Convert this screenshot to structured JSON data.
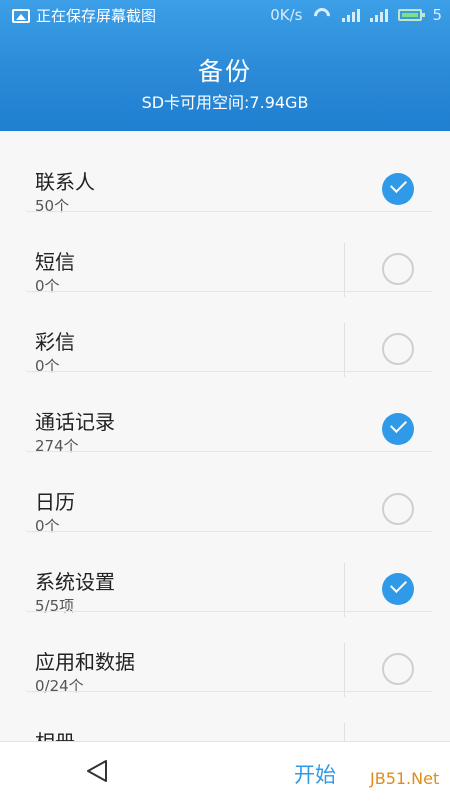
{
  "status_bar": {
    "notification_text": "正在保存屏幕截图",
    "notification_icon": "image-icon",
    "net_speed": "0K/s",
    "battery_level": "5"
  },
  "header": {
    "title": "备份",
    "subtitle": "SD卡可用空间:7.94GB"
  },
  "items": [
    {
      "name": "联系人",
      "count": "50个",
      "checked": true
    },
    {
      "name": "短信",
      "count": "0个",
      "checked": false
    },
    {
      "name": "彩信",
      "count": "0个",
      "checked": false
    },
    {
      "name": "通话记录",
      "count": "274个",
      "checked": true
    },
    {
      "name": "日历",
      "count": "0个",
      "checked": false
    },
    {
      "name": "系统设置",
      "count": "5/5项",
      "checked": true
    },
    {
      "name": "应用和数据",
      "count": "0/24个",
      "checked": false
    },
    {
      "name": "相册",
      "count": "",
      "checked": false
    }
  ],
  "bottom_bar": {
    "back_icon": "back-triangle-icon",
    "start_label": "开始"
  },
  "watermark": "JB51.Net",
  "colors": {
    "accent": "#2f9ae8",
    "header_top": "#3c9fe7",
    "header_bottom": "#1f7fd1"
  }
}
